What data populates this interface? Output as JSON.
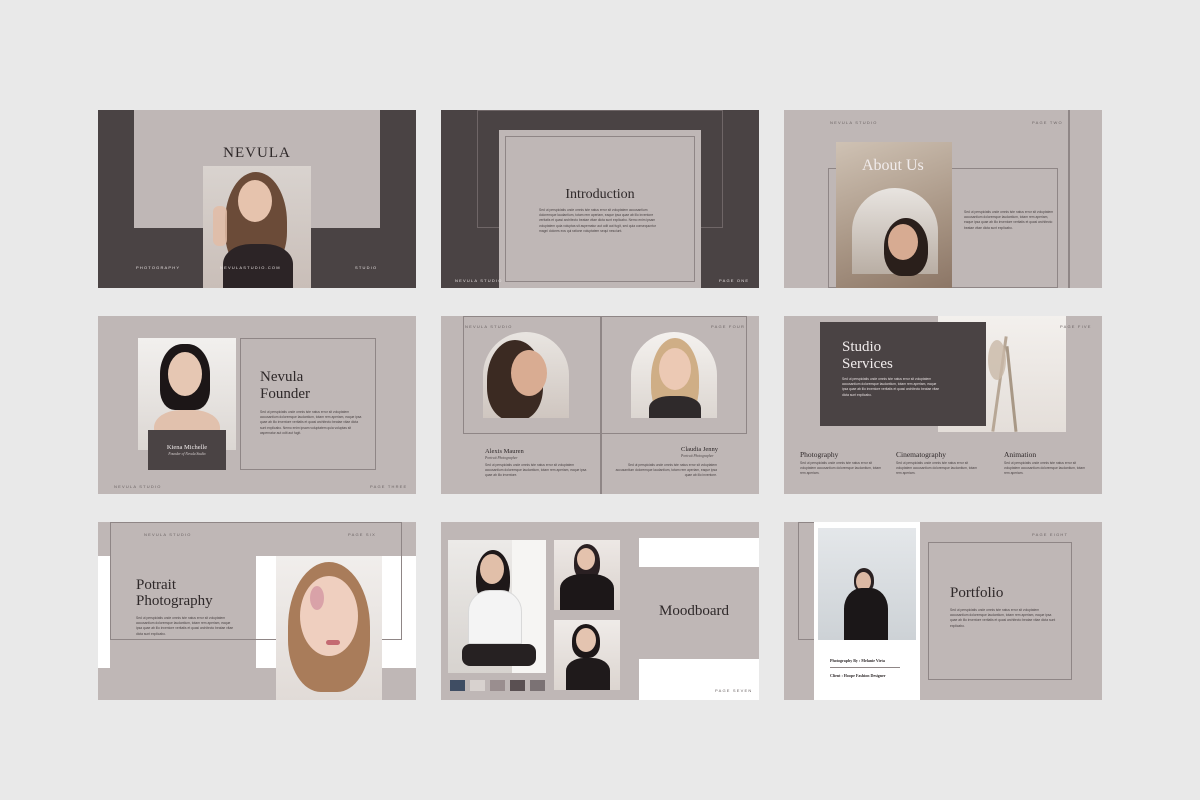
{
  "slides": {
    "s1": {
      "title": "NEVULA",
      "left_label": "PHOTOGRAPHY",
      "center_label": "NEVULASTUDIO.COM",
      "right_label": "STUDIO"
    },
    "s2": {
      "title": "Introduction",
      "footer_left": "NEVULA STUDIO",
      "footer_right": "PAGE ONE",
      "body": "Sed ut perspiciatis unde omnis iste natus error sit voluptatem accusantium doloremque laudantium, totam rem aperiam, eaque ipsa quae ab illo inventore veritatis et quasi architecto beatae vitae dicta sunt explicabo. Nemo enim ipsam voluptatem quia voluptas sit aspernatur aut odit aut fugit, sed quia consequuntur magni dolores eos qui ratione voluptatem sequi nesciunt."
    },
    "s3": {
      "title": "About Us",
      "header_left": "NEVULA STUDIO",
      "header_right": "PAGE TWO",
      "body": "Sed ut perspiciatis unde omnis iste natus error sit voluptatem accusantium doloremque laudantium, totam rem aperiam, eaque ipsa quae ab illo inventore veritatis et quasi architecto beatae vitae dicta sunt explicabo."
    },
    "s4": {
      "title_line1": "Nevula",
      "title_line2": "Founder",
      "card_name": "Kiena Michelle",
      "card_role": "Founder of Nevula Studio",
      "footer_left": "NEVULA STUDIO",
      "footer_right": "PAGE THREE",
      "body": "Sed ut perspiciatis unde omnis iste natus error sit voluptatem accusantium doloremque laudantium, totam rem aperiam, eaque ipsa quae ab illo inventore veritatis et quasi architecto beatae vitae dicta sunt explicabo. Nemo enim ipsam voluptatem quia voluptas sit aspernatur aut odit aut fugit."
    },
    "s5": {
      "header_left": "NEVULA STUDIO",
      "header_right": "PAGE FOUR",
      "left_name": "Alexis Mauren",
      "left_role": "Portrait Photographer",
      "right_name": "Claudia Jenny",
      "right_role": "Portrait Photographer",
      "body": "Sed ut perspiciatis unde omnis iste natus error sit voluptatem accusantium doloremque laudantium, totam rem aperiam, eaque ipsa quae ab illo inventore."
    },
    "s6": {
      "title_line1": "Studio",
      "title_line2": "Services",
      "header_right": "PAGE FIVE",
      "services": [
        "Photography",
        "Cinematography",
        "Animation"
      ],
      "body": "Sed ut perspiciatis unde omnis iste natus error sit voluptatem accusantium doloremque laudantium, totam rem aperiam, eaque ipsa quae ab illo inventore veritatis et quasi architecto beatae vitae dicta sunt explicabo.",
      "service_body": "Sed ut perspiciatis unde omnis iste natus error sit voluptatem accusantium doloremque laudantium, totam rem aperiam."
    },
    "s7": {
      "title_line1": "Potrait",
      "title_line2": "Photography",
      "header_left": "NEVULA STUDIO",
      "header_right": "PAGE SIX",
      "body": "Sed ut perspiciatis unde omnis iste natus error sit voluptatem accusantium doloremque laudantium, totam rem aperiam, eaque ipsa quae ab illo inventore veritatis et quasi architecto beatae vitae dicta sunt explicabo."
    },
    "s8": {
      "title": "Moodboard",
      "footer_right": "PAGE SEVEN",
      "swatches": [
        "#3f4d63",
        "#d8d2cf",
        "#9a8e8f",
        "#5a5052",
        "#7b7274"
      ]
    },
    "s9": {
      "title": "Portfolio",
      "header_right": "PAGE EIGHT",
      "credit1": "Photography By : Melanie Virta",
      "credit2": "Client : Hoope Fashion Designer",
      "body": "Sed ut perspiciatis unde omnis iste natus error sit voluptatem accusantium doloremque laudantium, totam rem aperiam, eaque ipsa quae ab illo inventore veritatis et quasi architecto beatae vitae dicta sunt explicabo."
    }
  },
  "colors": {
    "dark": "#4a4344",
    "taupe": "#bfb7b6",
    "background": "#e9e9e9",
    "white": "#ffffff"
  }
}
